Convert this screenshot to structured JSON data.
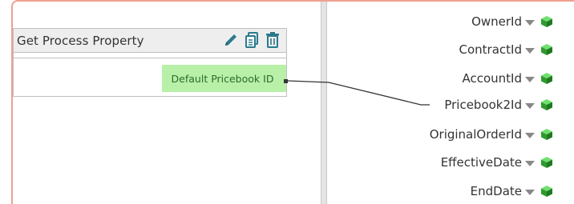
{
  "process_property_shape": {
    "title": "Get Process Property",
    "output_label": "Default Pricebook ID",
    "icons": [
      "pencil-icon",
      "copy-icon",
      "trash-icon"
    ]
  },
  "target_fields": [
    {
      "label": "OwnerId"
    },
    {
      "label": "ContractId"
    },
    {
      "label": "AccountId"
    },
    {
      "label": "Pricebook2Id"
    },
    {
      "label": "OriginalOrderId"
    },
    {
      "label": "EffectiveDate"
    },
    {
      "label": "EndDate"
    }
  ],
  "colors": {
    "frame_border": "#f0a090",
    "output_highlight": "#b8f0a8",
    "icon_teal": "#2a7a8c",
    "cube_green": "#3cb83c"
  }
}
